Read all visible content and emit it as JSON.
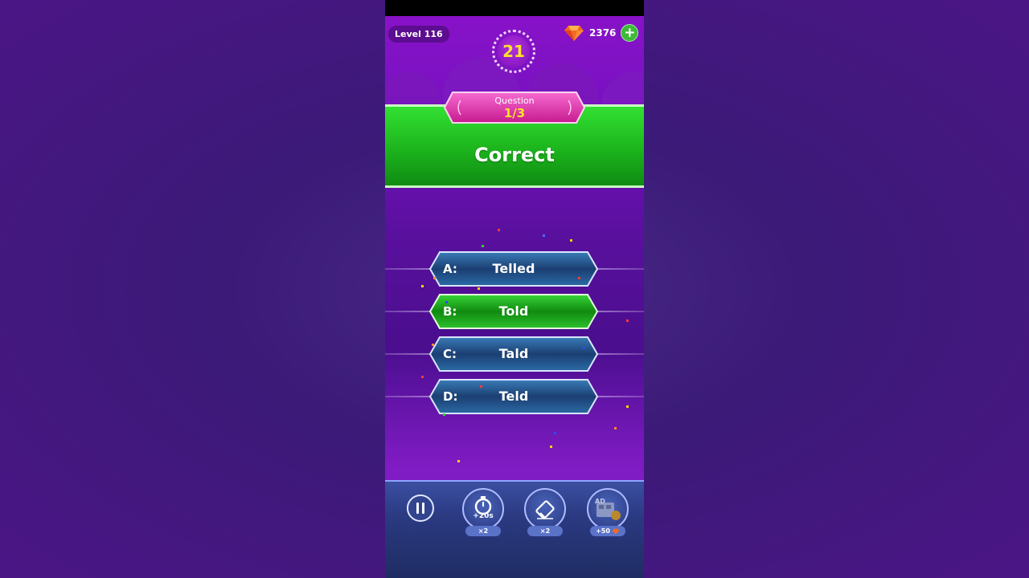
{
  "hud": {
    "level_label": "Level 116",
    "timer_value": "21",
    "gems_count": "2376",
    "add_gems_symbol": "+"
  },
  "question": {
    "label": "Question",
    "progress": "1/3"
  },
  "result": {
    "text": "Correct",
    "color": "#1eb81e"
  },
  "answers": [
    {
      "letter": "A:",
      "text": "Telled",
      "state": "default"
    },
    {
      "letter": "B:",
      "text": "Told",
      "state": "correct"
    },
    {
      "letter": "C:",
      "text": "Tald",
      "state": "default"
    },
    {
      "letter": "D:",
      "text": "Teld",
      "state": "default"
    }
  ],
  "powerups": {
    "pause_icon": "pause-icon",
    "time": {
      "icon": "stopwatch-icon",
      "label": "+20s",
      "count": "×2"
    },
    "eraser": {
      "icon": "eraser-icon",
      "count": "×2"
    },
    "ad": {
      "icon": "ad-video-icon",
      "badge": "AD",
      "count": "+50"
    }
  },
  "colors": {
    "accent_pink": "#e63fb1",
    "gold": "#ffe22a",
    "answer_default": "#1b3f72",
    "answer_correct": "#1db01d"
  }
}
